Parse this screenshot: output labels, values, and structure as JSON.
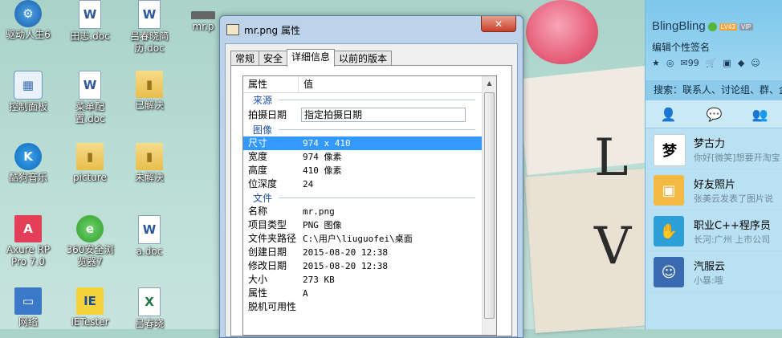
{
  "desktop": {
    "icons": [
      {
        "label": "驱动人生6",
        "icon": "driver-icon"
      },
      {
        "label": "田志.doc",
        "icon": "word-doc-icon"
      },
      {
        "label": "吕春晓简历.doc",
        "icon": "word-doc-icon"
      },
      {
        "label": "mr.p",
        "icon": "image-file-icon"
      },
      {
        "label": "控制面板",
        "icon": "control-panel-icon"
      },
      {
        "label": "菜单配置.doc",
        "icon": "word-doc-icon"
      },
      {
        "label": "已解决",
        "icon": "folder-icon"
      },
      {
        "label": "酷狗音乐",
        "icon": "kugou-icon"
      },
      {
        "label": "picture",
        "icon": "folder-icon"
      },
      {
        "label": "未解决",
        "icon": "folder-icon"
      },
      {
        "label": "Axure RP Pro 7.0",
        "icon": "axure-icon"
      },
      {
        "label": "360安全浏览器7",
        "icon": "browser-360-icon"
      },
      {
        "label": "a.doc",
        "icon": "word-doc-icon"
      },
      {
        "label": "网络",
        "icon": "network-icon"
      },
      {
        "label": "IETester",
        "icon": "ietester-icon"
      },
      {
        "label": "吕春晓",
        "icon": "excel-icon"
      }
    ]
  },
  "dialog": {
    "title": "mr.png 属性",
    "close": "✕",
    "tabs": [
      "常规",
      "安全",
      "详细信息",
      "以前的版本"
    ],
    "columns": {
      "property": "属性",
      "value": "值"
    },
    "sections": {
      "source": "来源",
      "image": "图像",
      "file": "文件"
    },
    "source_rows": [
      {
        "key": "拍摄日期",
        "value": "指定拍摄日期"
      }
    ],
    "image_rows": [
      {
        "key": "尺寸",
        "value": "974 x 410"
      },
      {
        "key": "宽度",
        "value": "974 像素"
      },
      {
        "key": "高度",
        "value": "410 像素"
      },
      {
        "key": "位深度",
        "value": "24"
      }
    ],
    "file_rows": [
      {
        "key": "名称",
        "value": "mr.png"
      },
      {
        "key": "项目类型",
        "value": "PNG 图像"
      },
      {
        "key": "文件夹路径",
        "value": "C:\\用户\\liuguofei\\桌面"
      },
      {
        "key": "创建日期",
        "value": "2015-08-20 12:38"
      },
      {
        "key": "修改日期",
        "value": "2015-08-20 12:38"
      },
      {
        "key": "大小",
        "value": "273 KB"
      },
      {
        "key": "属性",
        "value": "A"
      },
      {
        "key": "脱机可用性",
        "value": ""
      }
    ]
  },
  "qq": {
    "name": "BlingBling",
    "level": "LV43",
    "vip": "VIP",
    "signature": "编辑个性签名",
    "mail_count": "99",
    "search_placeholder": "搜索：联系人、讨论组、群、企",
    "tab_hint": "",
    "contacts": [
      {
        "name": "梦古力",
        "msg": "你好[微笑]想要开淘宝",
        "avatar_text": "梦",
        "color": "#ffffff"
      },
      {
        "name": "好友照片",
        "msg": "张美云发表了图片说",
        "avatar_text": "▣",
        "color": "#f4b942"
      },
      {
        "name": "职业C++程序员",
        "msg": "长河:广州 上市公司",
        "avatar_text": "✋",
        "color": "#2d9fd8"
      },
      {
        "name": "汽服云",
        "msg": "小暴:哦",
        "avatar_text": "☺",
        "color": "#3a6bb0"
      }
    ]
  }
}
